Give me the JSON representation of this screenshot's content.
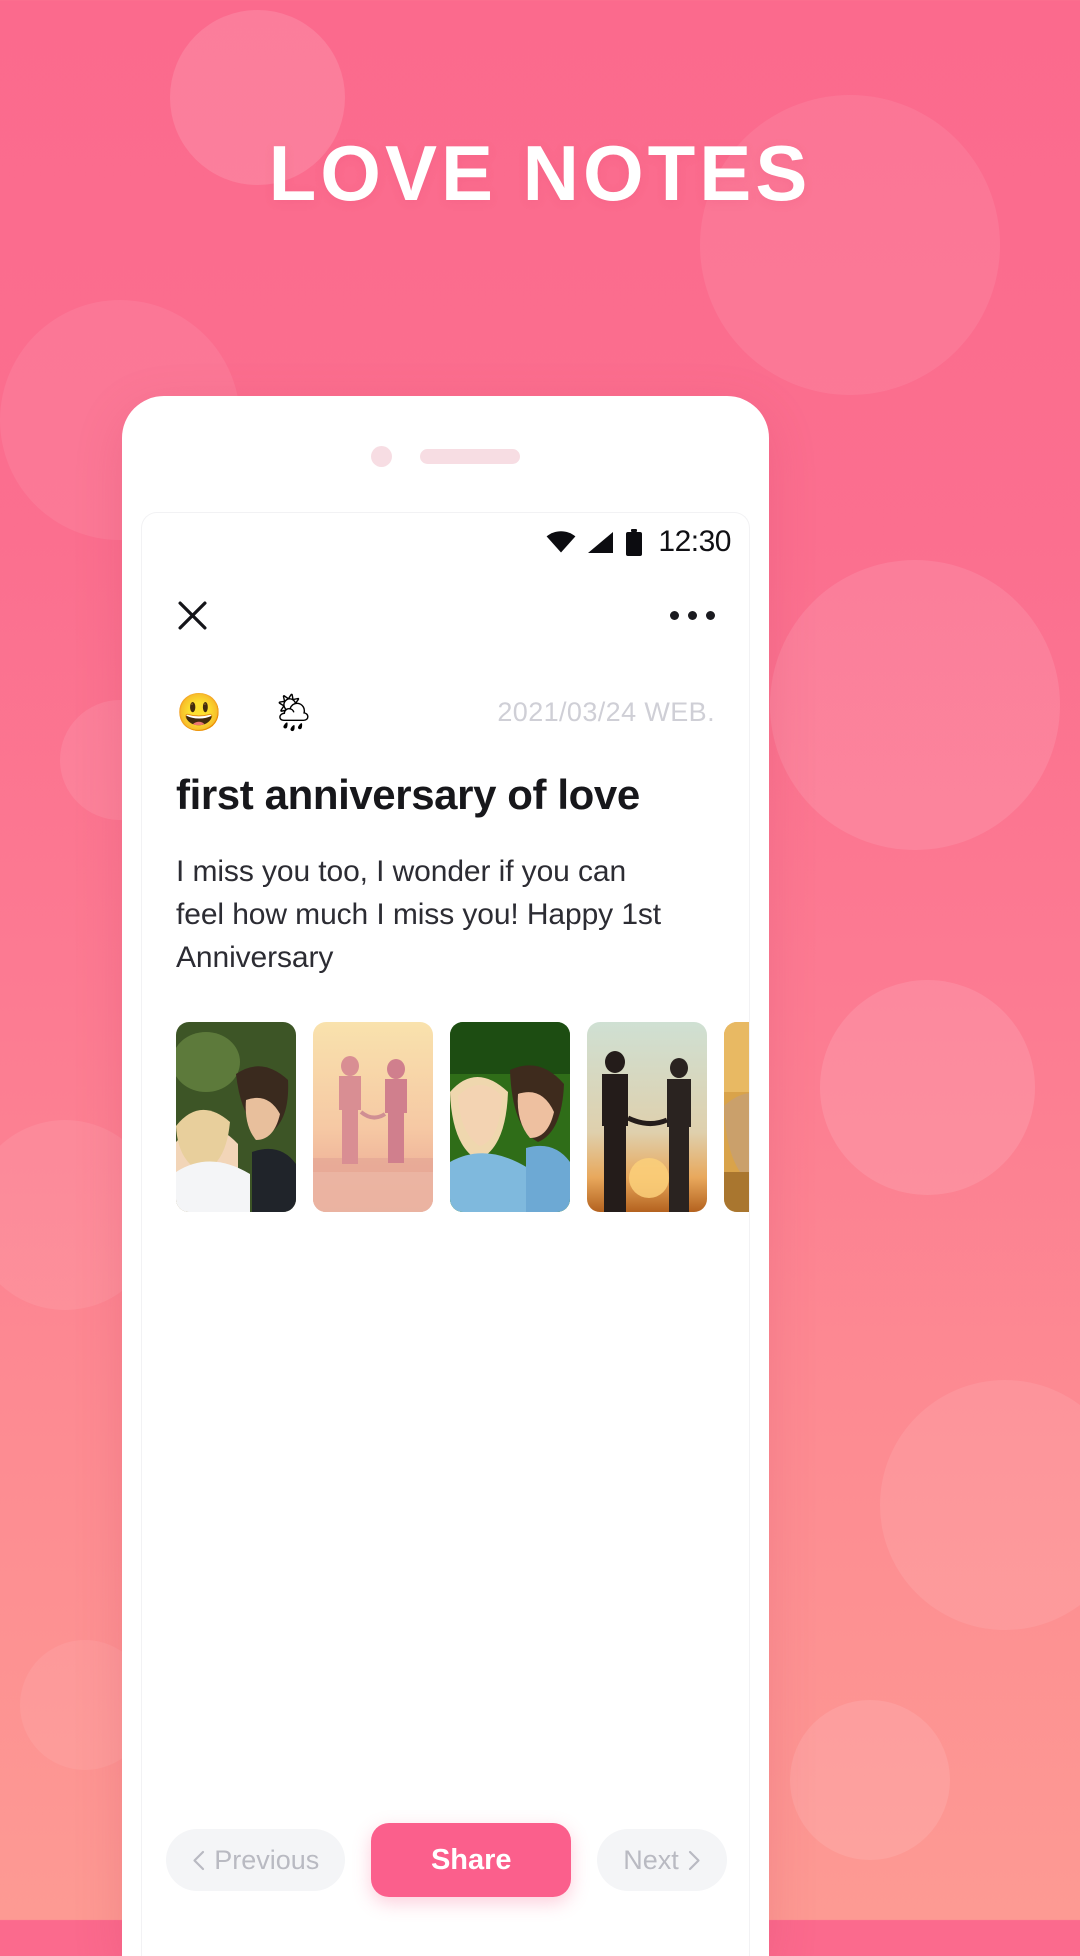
{
  "page": {
    "title": "LOVE NOTES",
    "background_top": "#fb6a8d",
    "background_bottom": "#fd9a93"
  },
  "phone": {
    "status_bar": {
      "wifi_icon": "wifi-icon",
      "signal_icon": "signal-icon",
      "battery_icon": "battery-icon",
      "time": "12:30"
    },
    "toolbar": {
      "close_icon": "close-icon",
      "more_icon": "more-options-icon"
    },
    "note": {
      "mood_emoji": "😃",
      "mood_name": "grinning-face-emoji",
      "weather_emoji": "🌦",
      "weather_name": "sun-behind-rain-cloud-icon",
      "date": "2021/03/24 WEB.",
      "title": "first anniversary of love",
      "body": "I miss you too, I wonder if you can feel how much I miss you! Happy 1st Anniversary"
    },
    "photos": [
      {
        "name": "couple-foreheads-together",
        "sky": "#2f4220",
        "tone": "#f0c9a8"
      },
      {
        "name": "couple-running-beach-sunset",
        "sky": "#f6d79d",
        "tone": "#e8a0a0"
      },
      {
        "name": "couple-lying-on-grass",
        "sky": "#2e6b18",
        "tone": "#f2cfae"
      },
      {
        "name": "couple-silhouette-sunset",
        "sky": "#cfe0d4",
        "tone": "#2a2220"
      },
      {
        "name": "couple-photo-partial",
        "sky": "#d9a34a",
        "tone": "#caa06b"
      }
    ],
    "footer": {
      "previous_label": "Previous",
      "share_label": "Share",
      "next_label": "Next",
      "accent_color": "#fb5f8c"
    }
  }
}
